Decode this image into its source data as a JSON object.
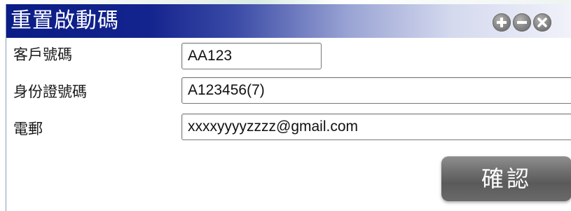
{
  "dialog": {
    "title": "重置啟動碼",
    "window_buttons": [
      {
        "icon": "plus-icon"
      },
      {
        "icon": "minus-icon"
      },
      {
        "icon": "close-icon"
      }
    ]
  },
  "form": {
    "customer_number": {
      "label": "客戶號碼",
      "value": "AA123"
    },
    "id_number": {
      "label": "身份證號碼",
      "value": "A123456(7)"
    },
    "email": {
      "label": "電郵",
      "value": "xxxxyyyyzzzz@gmail.com"
    }
  },
  "actions": {
    "confirm_label": "確認"
  },
  "colors": {
    "titlebar_start": "#0a1c86",
    "titlebar_end": "#f2f3fa",
    "button_gray": "#6e6e6e"
  }
}
